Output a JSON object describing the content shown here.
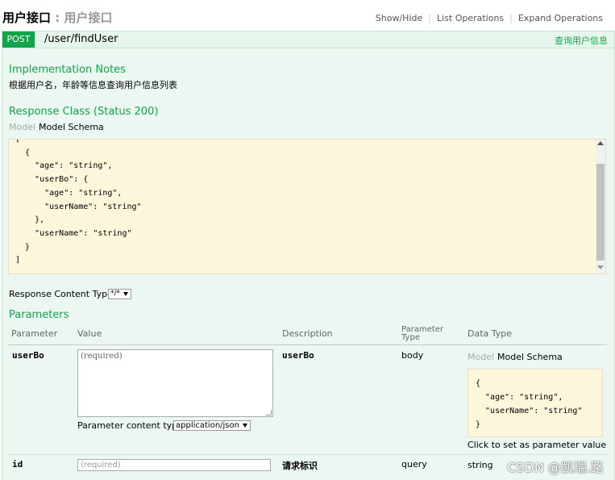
{
  "header": {
    "title": "用户接口",
    "separator": " : ",
    "subtitle": "用户接口",
    "ops": [
      "Show/Hide",
      "List Operations",
      "Expand Operations"
    ]
  },
  "operation": {
    "method": "POST",
    "path": "/user/findUser",
    "summary": "查询用户信息"
  },
  "notes": {
    "heading": "Implementation Notes",
    "text": "根据用户名，年龄等信息查询用户信息列表"
  },
  "response": {
    "heading": "Response Class (Status 200)",
    "tab_model": "Model",
    "tab_schema": "Model Schema",
    "schema": "[\n  {\n    \"age\": \"string\",\n    \"userBo\": {\n      \"age\": \"string\",\n      \"userName\": \"string\"\n    },\n    \"userName\": \"string\"\n  }\n]",
    "content_type_label": "Response Content Type",
    "content_type_value": "*/*"
  },
  "parameters": {
    "heading": "Parameters",
    "columns": {
      "parameter": "Parameter",
      "value": "Value",
      "description": "Description",
      "type_line1": "Parameter",
      "type_line2": "Type",
      "data_type": "Data Type"
    },
    "rows": [
      {
        "name": "userBo",
        "placeholder": "(required)",
        "description": "userBo",
        "param_type": "body",
        "content_type_label": "Parameter content type:",
        "content_type_value": "application/json",
        "tab_model": "Model",
        "tab_schema": "Model Schema",
        "schema": "{\n  \"age\": \"string\",\n  \"userName\": \"string\"\n}",
        "hint": "Click to set as parameter value"
      },
      {
        "name": "id",
        "placeholder": "(required)",
        "description": "请求标识",
        "param_type": "query",
        "data_type": "string"
      }
    ]
  },
  "watermark": "CSDN @凯瑞.路",
  "colors": {
    "post_green": "#10a54a",
    "operation_bg": "#ebf7f0",
    "snippet_bg": "#fcf6db"
  }
}
